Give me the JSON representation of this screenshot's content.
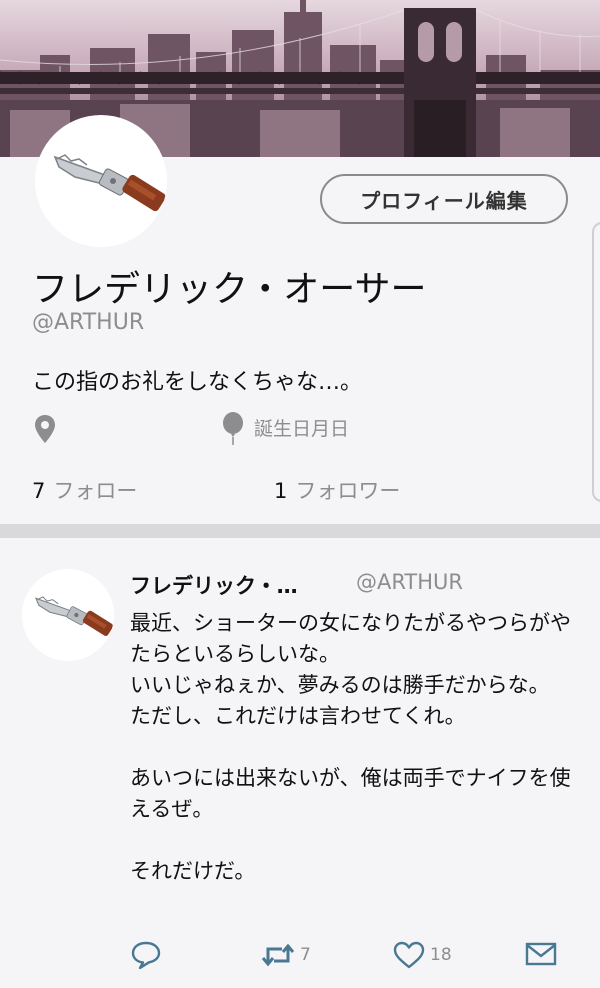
{
  "profile": {
    "edit_button": "プロフィール編集",
    "name": "フレデリック・オーサー",
    "handle": "@ARTHUR",
    "bio": "この指のお礼をしなくちゃな…。",
    "birthday": "誕生日月日",
    "following_count": "7",
    "following_label": "フォロー",
    "followers_count": "1",
    "followers_label": "フォロワー"
  },
  "tweet": {
    "name": "フレデリック・…",
    "handle": "@ARTHUR",
    "text": "最近、ショーターの女になりたがるやつらがやたらといるらしいな。\nいいじゃねぇか、夢みるのは勝手だからな。\nただし、これだけは言わせてくれ。\n\nあいつには出来ないが、俺は両手でナイフを使えるぜ。\n\nそれだけだ。",
    "retweet_count": "7",
    "like_count": "18"
  },
  "icons": {
    "location": "location-pin-icon",
    "birthday": "balloon-icon",
    "reply": "reply-bubble-icon",
    "retweet": "retweet-icon",
    "like": "heart-icon",
    "message": "envelope-icon"
  },
  "colors": {
    "background": "#f5f5f7",
    "muted_text": "#8d8d90",
    "icon_blue": "#4a7892"
  }
}
